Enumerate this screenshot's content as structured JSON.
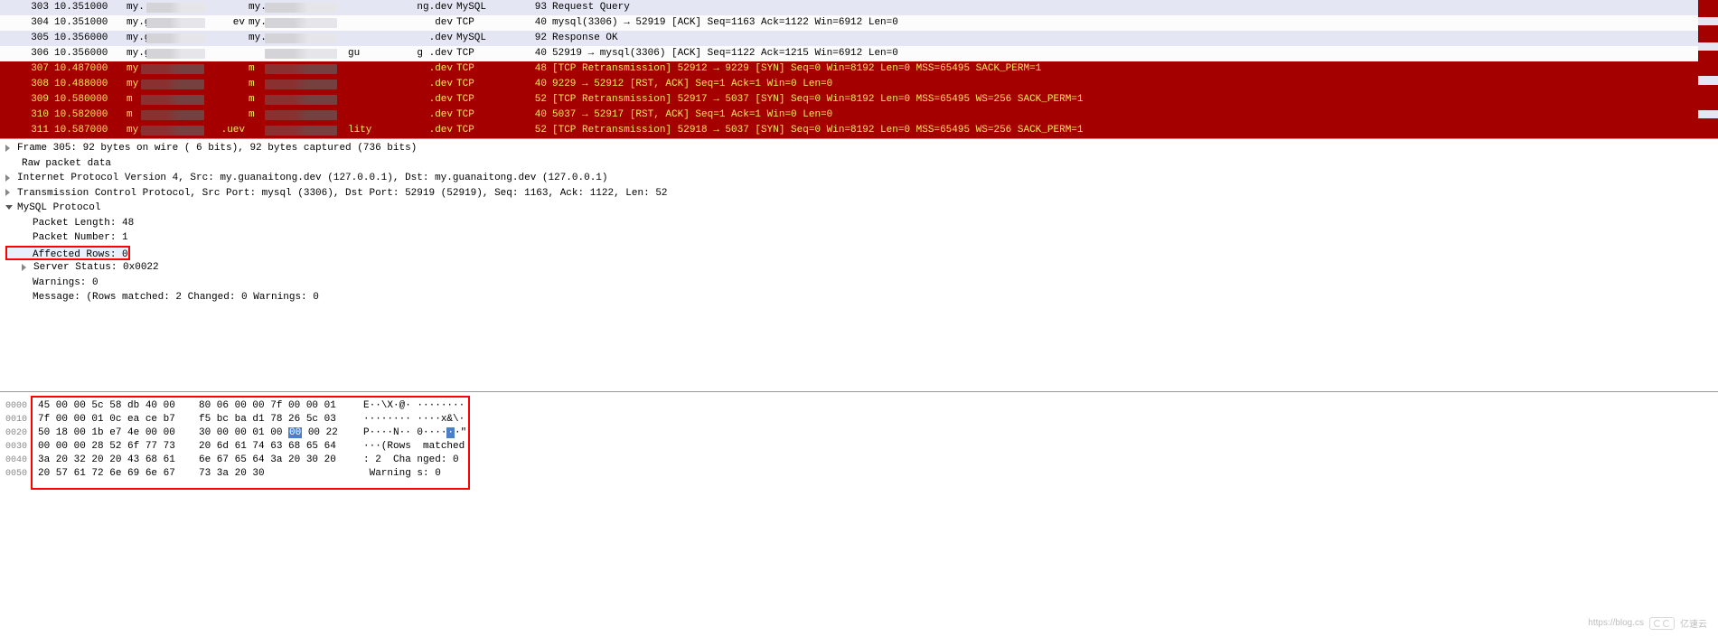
{
  "packets": [
    {
      "num": "303",
      "time": "10.351000",
      "src_prefix": "my.",
      "dst_prefix": "my.",
      "dst_suffix": "ng.dev",
      "proto": "MySQL",
      "len": "93",
      "info": "Request Query",
      "style": "normal"
    },
    {
      "num": "304",
      "time": "10.351000",
      "src_prefix": "my.gu",
      "src_suffix": "ev",
      "dst_prefix": "my.g",
      "dst_suffix": "dev",
      "proto": "TCP",
      "len": "40",
      "info": "mysql(3306) → 52919 [ACK] Seq=1163 Ack=1122 Win=6912 Len=0",
      "style": "normal2"
    },
    {
      "num": "305",
      "time": "10.356000",
      "src_prefix": "my.g",
      "dst_prefix": "my.",
      "dst_suffix": ".dev",
      "proto": "MySQL",
      "len": "92",
      "info": "Response OK",
      "style": "normal"
    },
    {
      "num": "306",
      "time": "10.356000",
      "src_prefix": "my.g",
      "dst_prefix": "",
      "dst_mid": "gu",
      "dst_suffix": "g .dev",
      "proto": "TCP",
      "len": "40",
      "info": "52919 → mysql(3306) [ACK] Seq=1122 Ack=1215 Win=6912 Len=0",
      "style": "normal2"
    },
    {
      "num": "307",
      "time": "10.487000",
      "src_prefix": "my",
      "dst_prefix": "m",
      "dst_suffix": ".dev",
      "proto": "TCP",
      "len": "48",
      "info": "[TCP Retransmission] 52912 → 9229 [SYN] Seq=0 Win=8192 Len=0 MSS=65495 SACK_PERM=1",
      "style": "red"
    },
    {
      "num": "308",
      "time": "10.488000",
      "src_prefix": "my",
      "dst_prefix": "m",
      "dst_suffix": ".dev",
      "proto": "TCP",
      "len": "40",
      "info": "9229 → 52912 [RST, ACK] Seq=1 Ack=1 Win=0 Len=0",
      "style": "red"
    },
    {
      "num": "309",
      "time": "10.580000",
      "src_prefix": "m",
      "dst_prefix": "m",
      "dst_suffix": ".dev",
      "proto": "TCP",
      "len": "52",
      "info": "[TCP Retransmission] 52917 → 5037 [SYN] Seq=0 Win=8192 Len=0 MSS=65495 WS=256 SACK_PERM=1",
      "style": "red"
    },
    {
      "num": "310",
      "time": "10.582000",
      "src_prefix": "m",
      "dst_prefix": "m",
      "dst_suffix": ".dev",
      "proto": "TCP",
      "len": "40",
      "info": "5037 → 52917 [RST, ACK] Seq=1 Ack=1 Win=0 Len=0",
      "style": "red"
    },
    {
      "num": "311",
      "time": "10.587000",
      "src_prefix": "my.gu",
      "src_suffix": ".uev",
      "dst_prefix": "",
      "dst_mid": "lity",
      "dst_suffix": ".dev",
      "proto": "TCP",
      "len": "52",
      "info": "[TCP Retransmission] 52918 → 5037 [SYN] Seq=0 Win=8192 Len=0 MSS=65495 WS=256 SACK_PERM=1",
      "style": "red"
    }
  ],
  "details": {
    "frame": "Frame 305: 92 bytes on wire (    6 bits), 92 bytes captured (736 bits)",
    "raw": "Raw packet data",
    "ip": "Internet Protocol Version 4, Src: my.guanaitong.dev (127.0.0.1), Dst: my.guanaitong.dev (127.0.0.1)",
    "tcp": "Transmission Control Protocol, Src Port: mysql (3306), Dst Port: 52919 (52919), Seq: 1163, Ack: 1122, Len: 52",
    "mysql": "MySQL Protocol",
    "pkt_len": "Packet Length: 48",
    "pkt_num": "Packet Number: 1",
    "affected": "Affected Rows: 0",
    "server_status": "Server Status: 0x0022",
    "warnings": "Warnings: 0",
    "message": "Message: (Rows matched: 2  Changed: 0  Warnings: 0"
  },
  "hex": {
    "lines": [
      {
        "offset": "0000",
        "b1": "45 00 00 5c 58 db 40 00",
        "b2": "80 06 00 00 7f 00 00 01",
        "ascii": "E··\\X·@· ········"
      },
      {
        "offset": "0010",
        "b1": "7f 00 00 01 0c ea ce b7",
        "b2": "f5 bc ba d1 78 26 5c 03",
        "ascii": "········ ····x&\\·"
      },
      {
        "offset": "0020",
        "b1": "50 18 00 1b e7 4e 00 00",
        "b2": "30 00 00 01 00 ",
        "b2_hl": "00",
        "b2_tail": " 00 22",
        "ascii": "P····N·· 0····",
        "ascii_hl": "·",
        "ascii_tail": "·\""
      },
      {
        "offset": "0030",
        "b1": "00 00 00 28 52 6f 77 73",
        "b2": "20 6d 61 74 63 68 65 64",
        "ascii": "···(Rows  matched"
      },
      {
        "offset": "0040",
        "b1": "3a 20 32 20 20 43 68 61",
        "b2": "6e 67 65 64 3a 20 30 20",
        "ascii": ": 2  Cha nged: 0 "
      },
      {
        "offset": "0050",
        "b1": "20 57 61 72 6e 69 6e 67",
        "b2": "73 3a 20 30",
        "ascii": " Warning s: 0"
      }
    ]
  },
  "minimap_colors": [
    "#a40000",
    "#a40000",
    "#e4e7f3",
    "#a40000",
    "#a40000",
    "#e4e7f3",
    "#a40000",
    "#a40000",
    "#a40000",
    "#e4e7f3",
    "#a40000",
    "#a40000",
    "#a40000",
    "#e4e7f3",
    "#a40000",
    "#a40000"
  ],
  "watermark": {
    "url": "https://blog.cs",
    "brand": "亿速云"
  }
}
